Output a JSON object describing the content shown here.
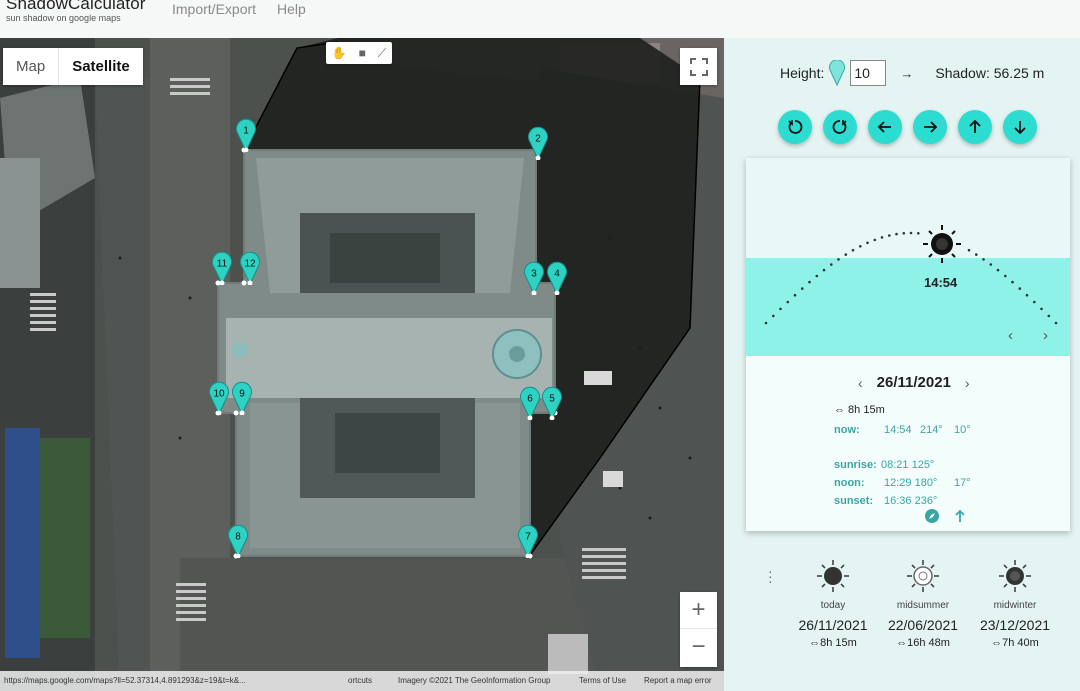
{
  "app": {
    "title": "ShadowCalculator",
    "subtitle": "sun shadow on google maps",
    "nav": [
      "Import/Export",
      "Help"
    ]
  },
  "map": {
    "type_buttons": [
      "Map",
      "Satellite"
    ],
    "selected_type": "Satellite",
    "markers": [
      "1",
      "2",
      "3",
      "4",
      "5",
      "6",
      "7",
      "8",
      "9",
      "10",
      "11",
      "12"
    ],
    "zoom_in": "+",
    "zoom_out": "−",
    "footer": {
      "url": "https://maps.google.com/maps?ll=52.37314,4.891293&z=19&t=k&...",
      "shortcuts": "ortcuts",
      "imagery": "Imagery ©2021 The GeoInformation Group",
      "terms": "Terms of Use",
      "report": "Report a map error"
    }
  },
  "controls": {
    "height_label": "Height:",
    "height_value": "10",
    "arrow": "→",
    "shadow_text": "Shadow: 56.25 m",
    "buttons": [
      "rotate-left-icon",
      "rotate-right-icon",
      "arrow-left-icon",
      "arrow-right-icon",
      "arrow-up-icon",
      "arrow-down-icon"
    ],
    "accent": "#2ddcd0"
  },
  "sun": {
    "time": "14:54",
    "date": "26/11/2021",
    "day_length": "⇔ 8h 15m",
    "now_label": "now:",
    "now_time": "14:54",
    "now_azimuth": "214°",
    "now_altitude": "10°",
    "sunrise_label": "sunrise:",
    "sunrise_value": "08:21 125°",
    "noon_label": "noon:",
    "noon_value": "12:29 180°",
    "noon_altitude": "17°",
    "sunset_label": "sunset:",
    "sunset_value": "16:36 236°",
    "prev": "‹",
    "next": "›"
  },
  "presets": [
    {
      "label": "today",
      "date": "26/11/2021",
      "length": "⇔8h 15m"
    },
    {
      "label": "midsummer",
      "date": "22/06/2021",
      "length": "⇔16h 48m"
    },
    {
      "label": "midwinter",
      "date": "23/12/2021",
      "length": "⇔7h 40m"
    }
  ]
}
